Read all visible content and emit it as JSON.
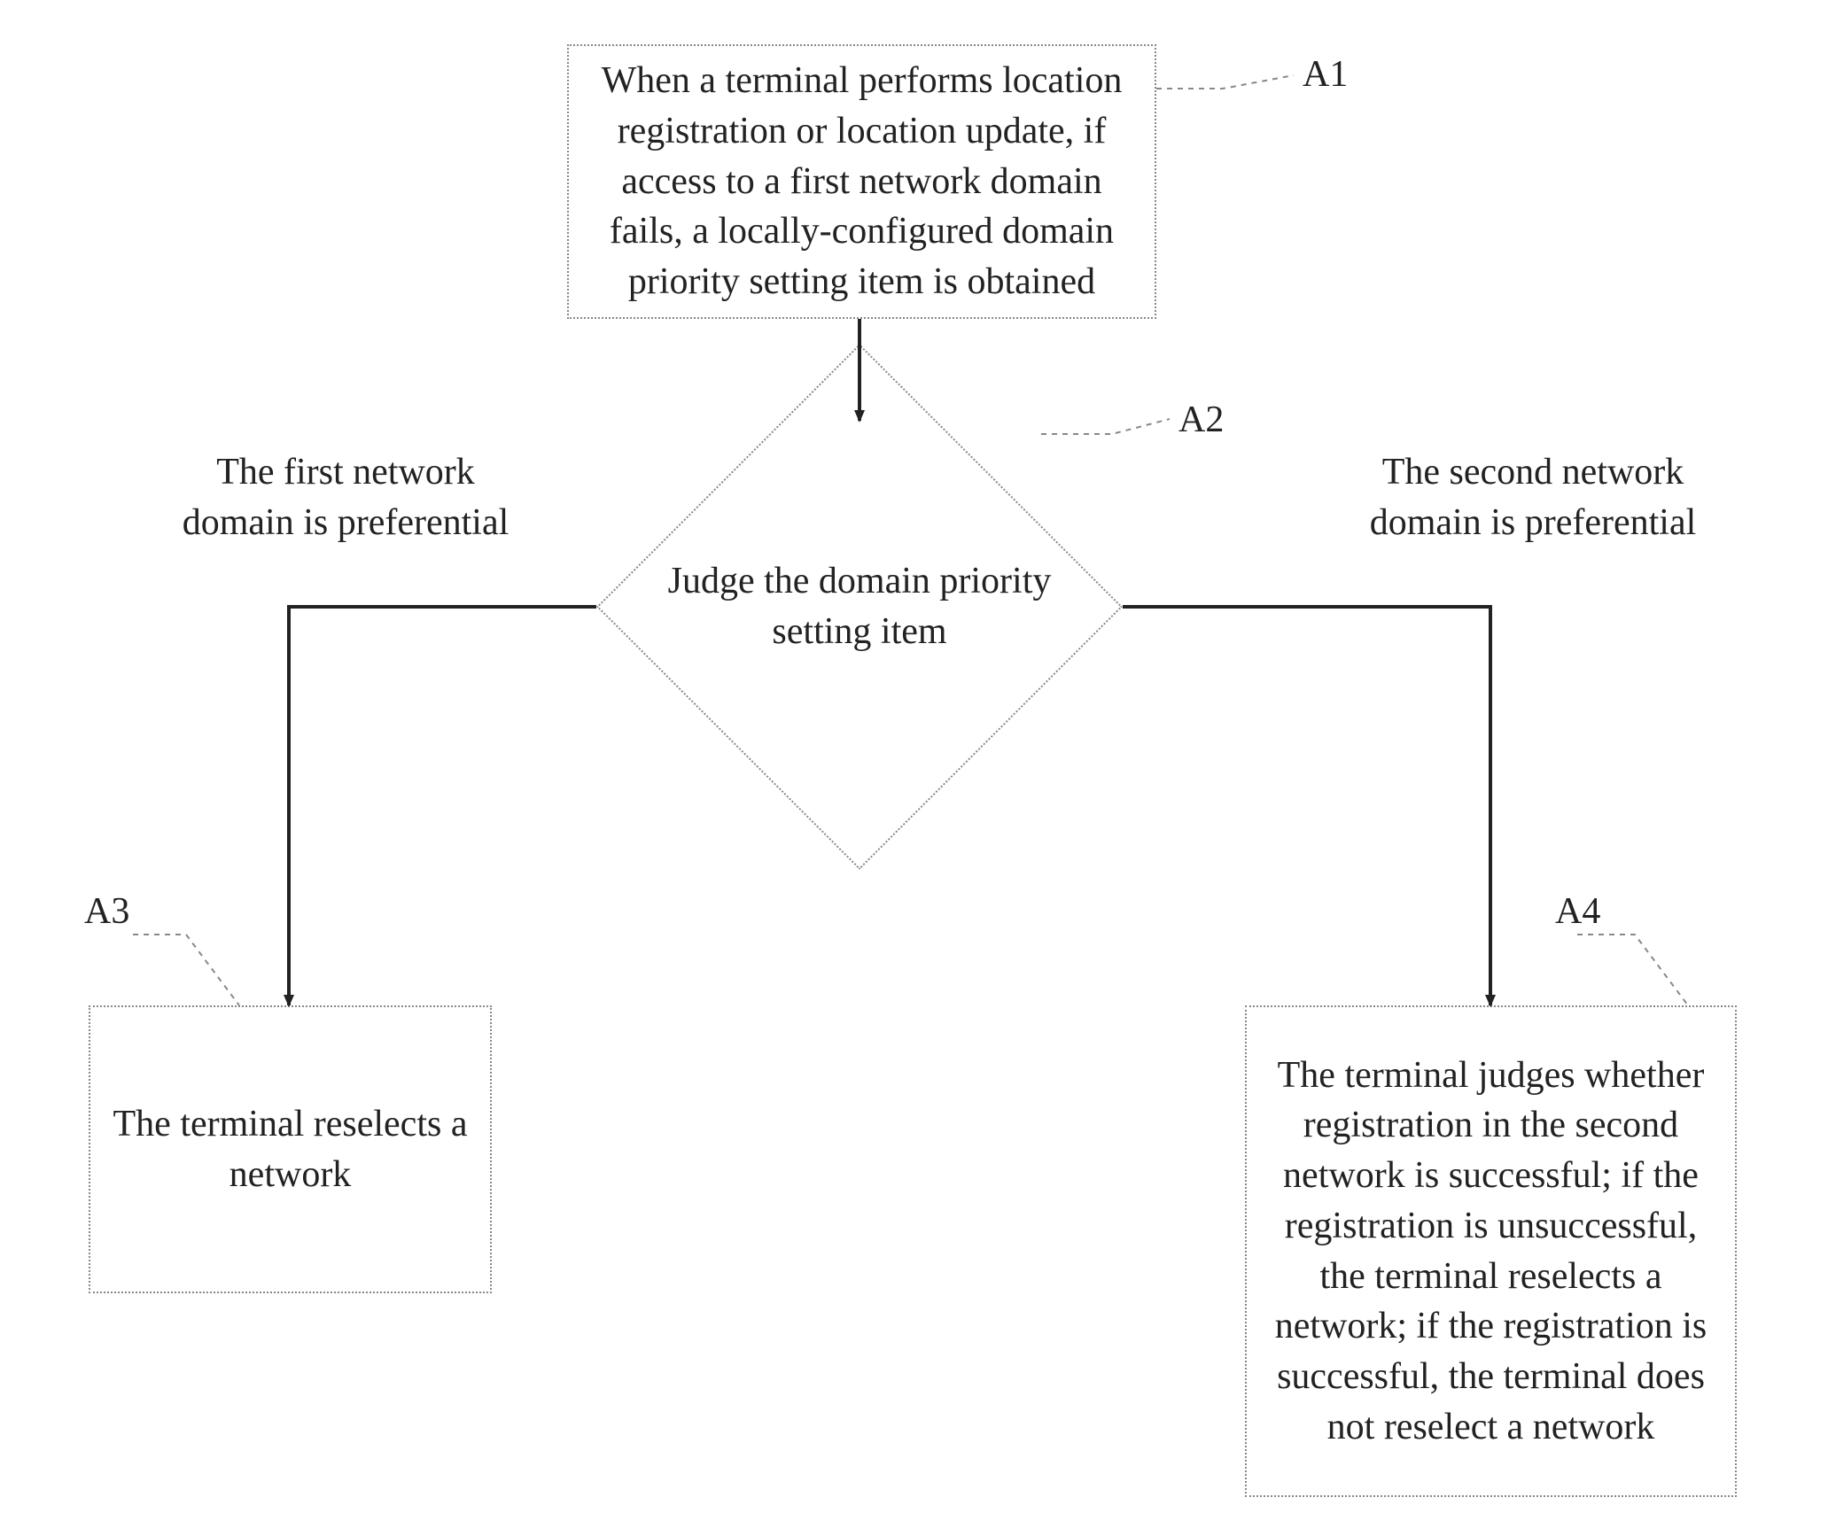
{
  "refs": {
    "a1": "A1",
    "a2": "A2",
    "a3": "A3",
    "a4": "A4"
  },
  "nodes": {
    "a1_text": "When a terminal performs location registration or location update, if access to a first network domain fails, a locally-configured domain priority setting item is obtained",
    "a2_text": "Judge the domain priority setting item",
    "a3_text": "The terminal reselects a network",
    "a4_text": "The terminal judges whether registration in the second network is successful; if the registration is unsuccessful, the terminal reselects a network; if the registration is successful, the terminal does not reselect a network"
  },
  "edges": {
    "left_label": "The first network domain is preferential",
    "right_label": "The second network domain is preferential"
  }
}
